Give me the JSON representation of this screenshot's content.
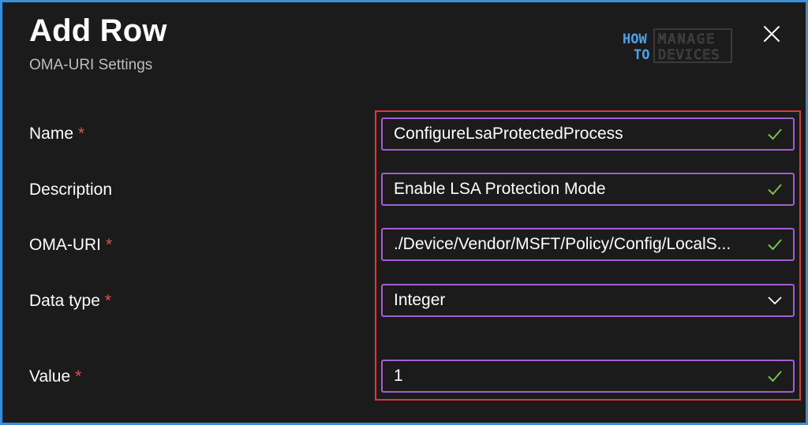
{
  "header": {
    "title": "Add Row",
    "subtitle": "OMA-URI Settings"
  },
  "logo": {
    "line1_left": "HOW",
    "line1_right": "MANAGE",
    "line2_left": "TO",
    "line2_right": "DEVICES"
  },
  "form": {
    "required_marker": "*",
    "name": {
      "label": "Name",
      "value": "ConfigureLsaProtectedProcess"
    },
    "description": {
      "label": "Description",
      "value": "Enable LSA Protection Mode"
    },
    "oma_uri": {
      "label": "OMA-URI",
      "value": "./Device/Vendor/MSFT/Policy/Config/LocalS..."
    },
    "data_type": {
      "label": "Data type",
      "value": "Integer"
    },
    "value": {
      "label": "Value",
      "value": "1"
    }
  },
  "colors": {
    "border_accent": "#3a8fd8",
    "field_border": "#a35fd1",
    "highlight_box": "#d93a3a",
    "check": "#7cc242",
    "required": "#e24f4f"
  },
  "icons": {
    "close": "close-icon",
    "valid": "checkmark-icon",
    "dropdown": "chevron-down-icon"
  }
}
